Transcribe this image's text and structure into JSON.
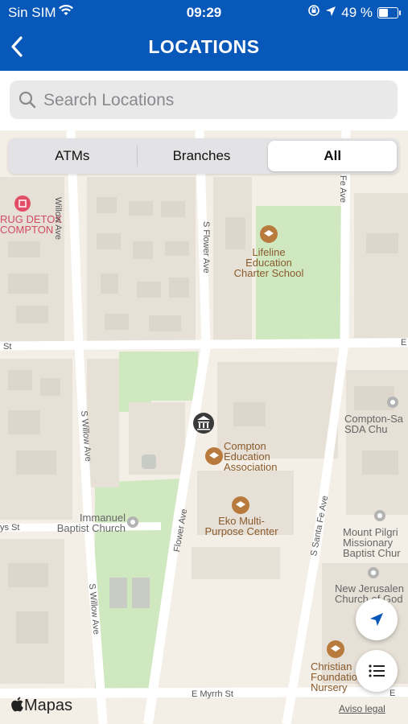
{
  "status": {
    "carrier": "Sin SIM",
    "time": "09:29",
    "battery": "49 %",
    "battery_level": 0.49
  },
  "header": {
    "title": "LOCATIONS"
  },
  "search": {
    "placeholder": "Search Locations"
  },
  "segments": [
    {
      "label": "ATMs",
      "active": false
    },
    {
      "label": "Branches",
      "active": false
    },
    {
      "label": "All",
      "active": true
    }
  ],
  "map": {
    "pois": {
      "drug_detox": [
        "RUG DETOX",
        "COMPTON"
      ],
      "lifeline": [
        "Lifeline",
        "Education",
        "Charter School"
      ],
      "compton_edu": [
        "Compton",
        "Education",
        "Association"
      ],
      "eko": [
        "Eko Multi-",
        "Purpose Center"
      ],
      "immanuel": [
        "Immanuel",
        "Baptist Church"
      ],
      "compton_sda": [
        "Compton-Sa",
        "SDA Chu"
      ],
      "mount_pilgrim": [
        "Mount Pilgri",
        "Missionary",
        "Baptist Chur"
      ],
      "new_jerusalem": [
        "New Jerusalen",
        "Church of God"
      ],
      "christian": [
        "Christian",
        "Foundatio",
        "Nursery"
      ]
    },
    "streets": {
      "willow_top": "Willow Ave",
      "flower_top": "S Flower Ave",
      "santa_fe_top": "Fe Ave",
      "st_left": "St",
      "st_right": "E",
      "s_willow": "S Willow Ave",
      "flower": "Flower Ave",
      "s_santa_fe": "S Santa Fe Ave",
      "ys_st": "ys St",
      "s_willow_bottom": "S Willow Ave",
      "myrrh": "E Myrrh St",
      "e_bottom": "E"
    },
    "attribution": {
      "brand": "Mapas",
      "legal": "Aviso legal"
    }
  },
  "colors": {
    "header": "#0758b8",
    "map_bg": "#f4efe6",
    "park": "#cfe8c0",
    "road": "#ffffff",
    "building": "#e6e0d6",
    "poi_brown": "#b87b3d"
  }
}
